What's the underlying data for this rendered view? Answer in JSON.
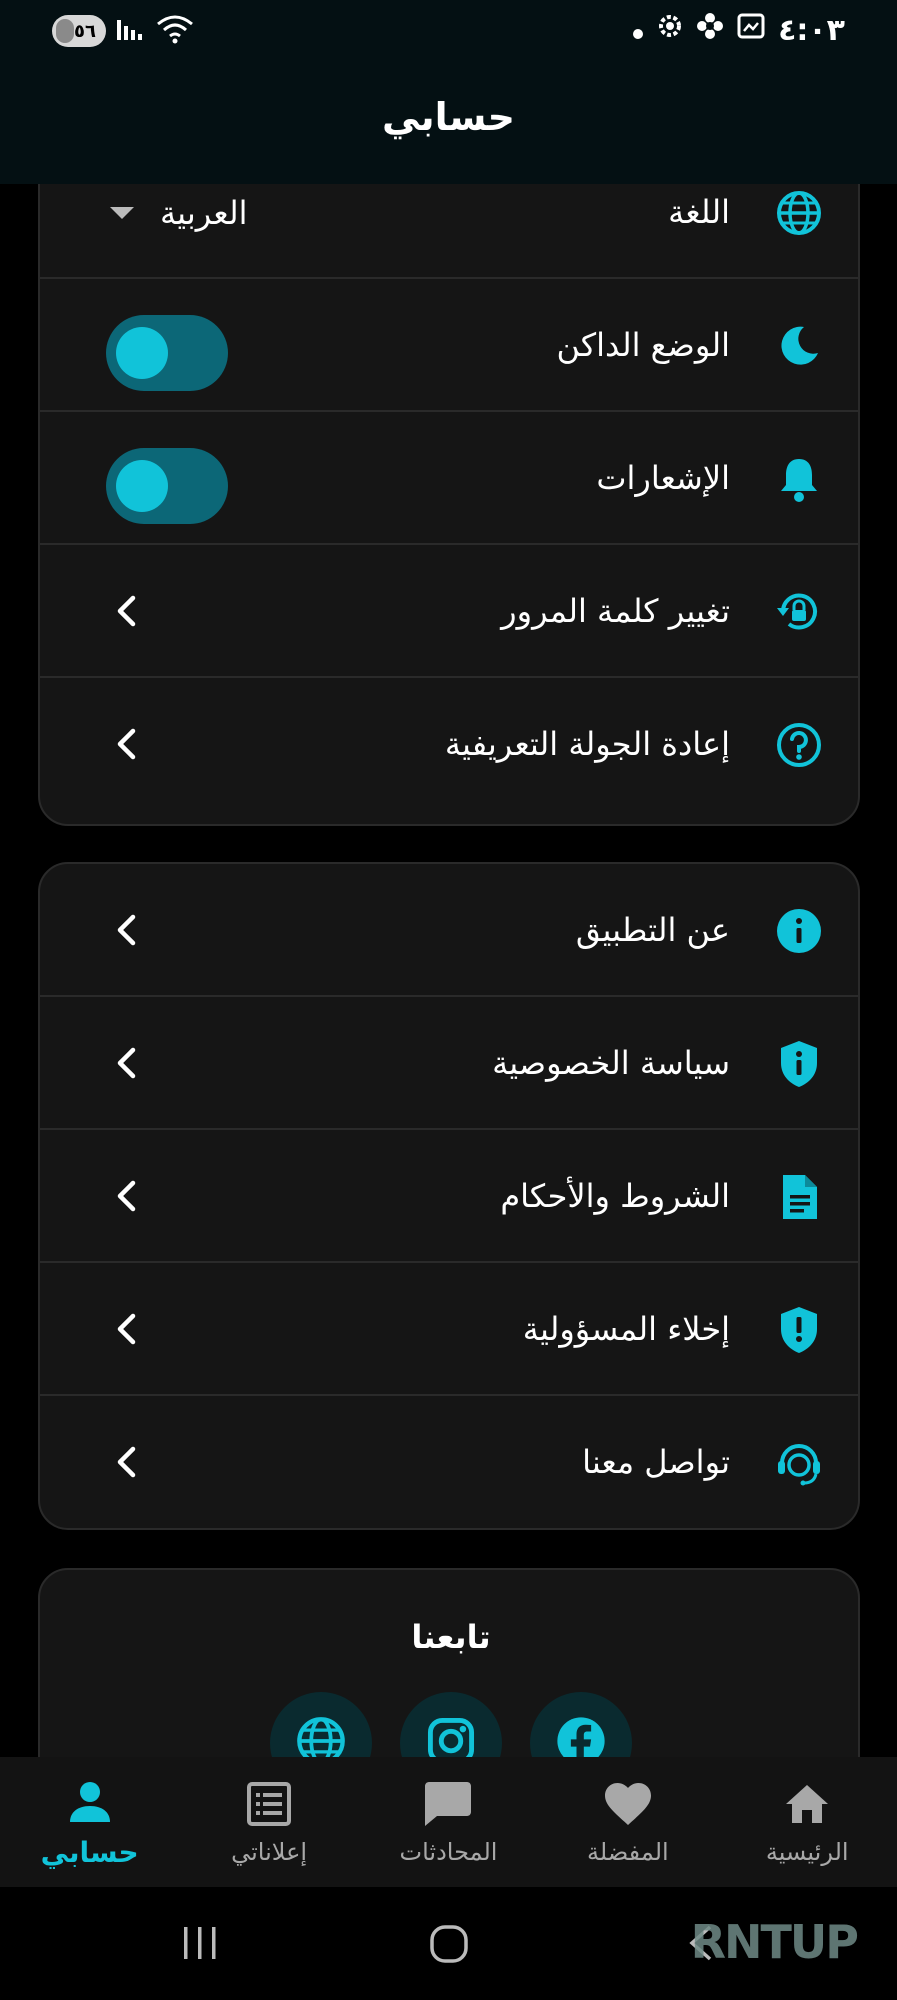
{
  "status_bar": {
    "time": "٤:٠٣",
    "battery": "٥٦"
  },
  "app_bar": {
    "title": "حسابي"
  },
  "settings": {
    "language": {
      "label": "اللغة",
      "value": "العربية"
    },
    "dark_mode": {
      "label": "الوضع الداكن",
      "enabled": false
    },
    "notifications": {
      "label": "الإشعارات",
      "enabled": false
    },
    "change_password": {
      "label": "تغيير كلمة المرور"
    },
    "replay_tour": {
      "label": "إعادة الجولة التعريفية"
    }
  },
  "info": {
    "about": {
      "label": "عن التطبيق"
    },
    "privacy": {
      "label": "سياسة الخصوصية"
    },
    "terms": {
      "label": "الشروط والأحكام"
    },
    "disclaimer": {
      "label": "إخلاء المسؤولية"
    },
    "contact": {
      "label": "تواصل معنا"
    }
  },
  "follow": {
    "title": "تابعنا",
    "icons": [
      "globe-icon",
      "instagram-icon",
      "facebook-icon"
    ]
  },
  "bottom_nav": {
    "home": "الرئيسية",
    "favorites": "المفضلة",
    "chats": "المحادثات",
    "my_ads": "إعلاناتي",
    "account": "حسابي"
  },
  "watermark": "RNTUP",
  "colors": {
    "accent": "#11c3d9",
    "background": "#000000",
    "card": "#151515",
    "appbar": "#041013"
  }
}
